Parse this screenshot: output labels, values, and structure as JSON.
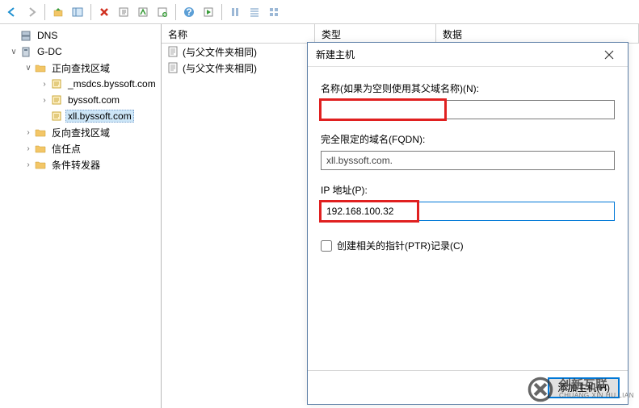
{
  "toolbar": {
    "back": "后退",
    "forward": "前进",
    "up": "上移",
    "show": "显示",
    "delete": "删除",
    "refresh": "刷新",
    "export": "导出",
    "new": "新建",
    "help": "帮助",
    "run": "运行",
    "list1": "列表",
    "list2": "详细",
    "list3": "图标"
  },
  "tree": {
    "root": "DNS",
    "server": "G-DC",
    "fwd_zone": "正向查找区域",
    "zone_msdcs": "_msdcs.byssoft.com",
    "zone_byssoft": "byssoft.com",
    "zone_xll": "xll.byssoft.com",
    "rev_zone": "反向查找区域",
    "trust": "信任点",
    "cond_fwd": "条件转发器"
  },
  "list": {
    "col_name": "名称",
    "col_type": "类型",
    "col_data": "数据",
    "row1": "(与父文件夹相同)",
    "row2": "(与父文件夹相同)"
  },
  "dialog": {
    "title": "新建主机",
    "label_name": "名称(如果为空则使用其父域名称)(N):",
    "name_value": "",
    "label_fqdn": "完全限定的域名(FQDN):",
    "fqdn_value": "xll.byssoft.com.",
    "label_ip": "IP 地址(P):",
    "ip_value": "192.168.100.32",
    "check_ptr": "创建相关的指针(PTR)记录(C)",
    "btn_add": "添加主机(H)"
  },
  "watermark": {
    "cn": "创新互联",
    "en": "CHUANG XIN HU LIAN"
  }
}
